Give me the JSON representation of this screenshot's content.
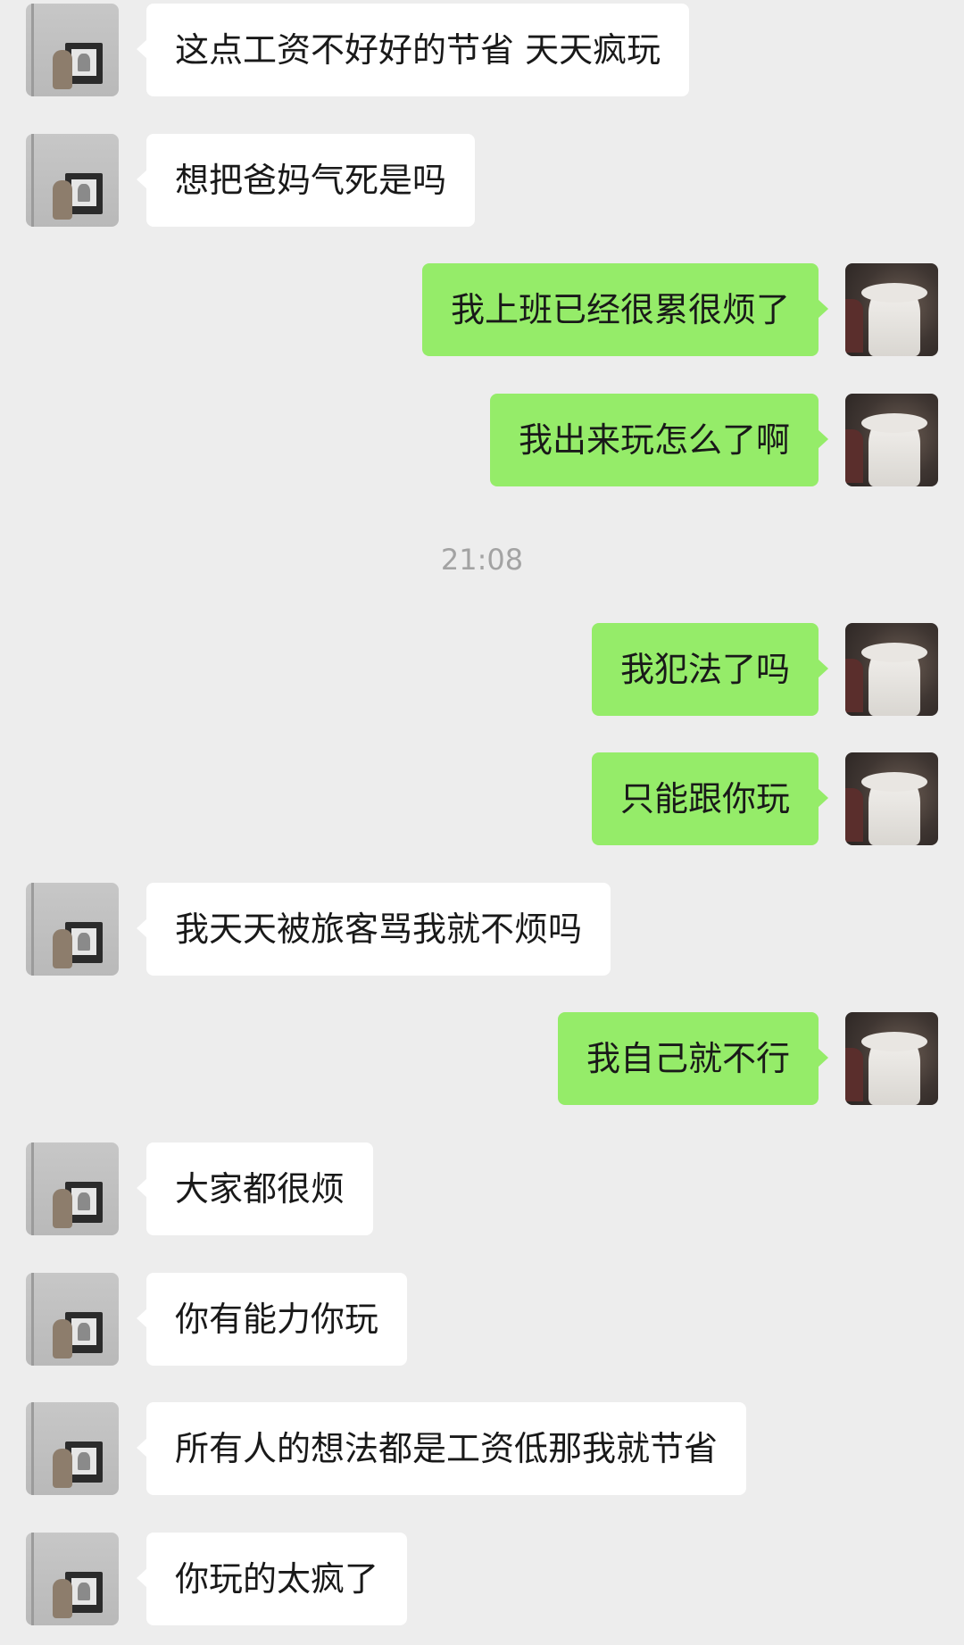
{
  "chat": {
    "messages": [
      {
        "side": "left",
        "text": "这点工资不好好的节省 天天疯玩"
      },
      {
        "side": "left",
        "text": "想把爸妈气死是吗"
      },
      {
        "side": "right",
        "text": "我上班已经很累很烦了"
      },
      {
        "side": "right",
        "text": "我出来玩怎么了啊"
      },
      {
        "side": "right",
        "text": "我犯法了吗"
      },
      {
        "side": "right",
        "text": "只能跟你玩"
      },
      {
        "side": "left",
        "text": "我天天被旅客骂我就不烦吗"
      },
      {
        "side": "right",
        "text": "我自己就不行"
      },
      {
        "side": "left",
        "text": "大家都很烦"
      },
      {
        "side": "left",
        "text": "你有能力你玩"
      },
      {
        "side": "left",
        "text": "所有人的想法都是工资低那我就节省"
      },
      {
        "side": "left",
        "text": "你玩的太疯了"
      }
    ],
    "timestamp": "21:08"
  },
  "colors": {
    "background": "#ededed",
    "incoming_bubble": "#ffffff",
    "outgoing_bubble": "#95ec69",
    "timestamp_text": "#a3a3a3"
  }
}
